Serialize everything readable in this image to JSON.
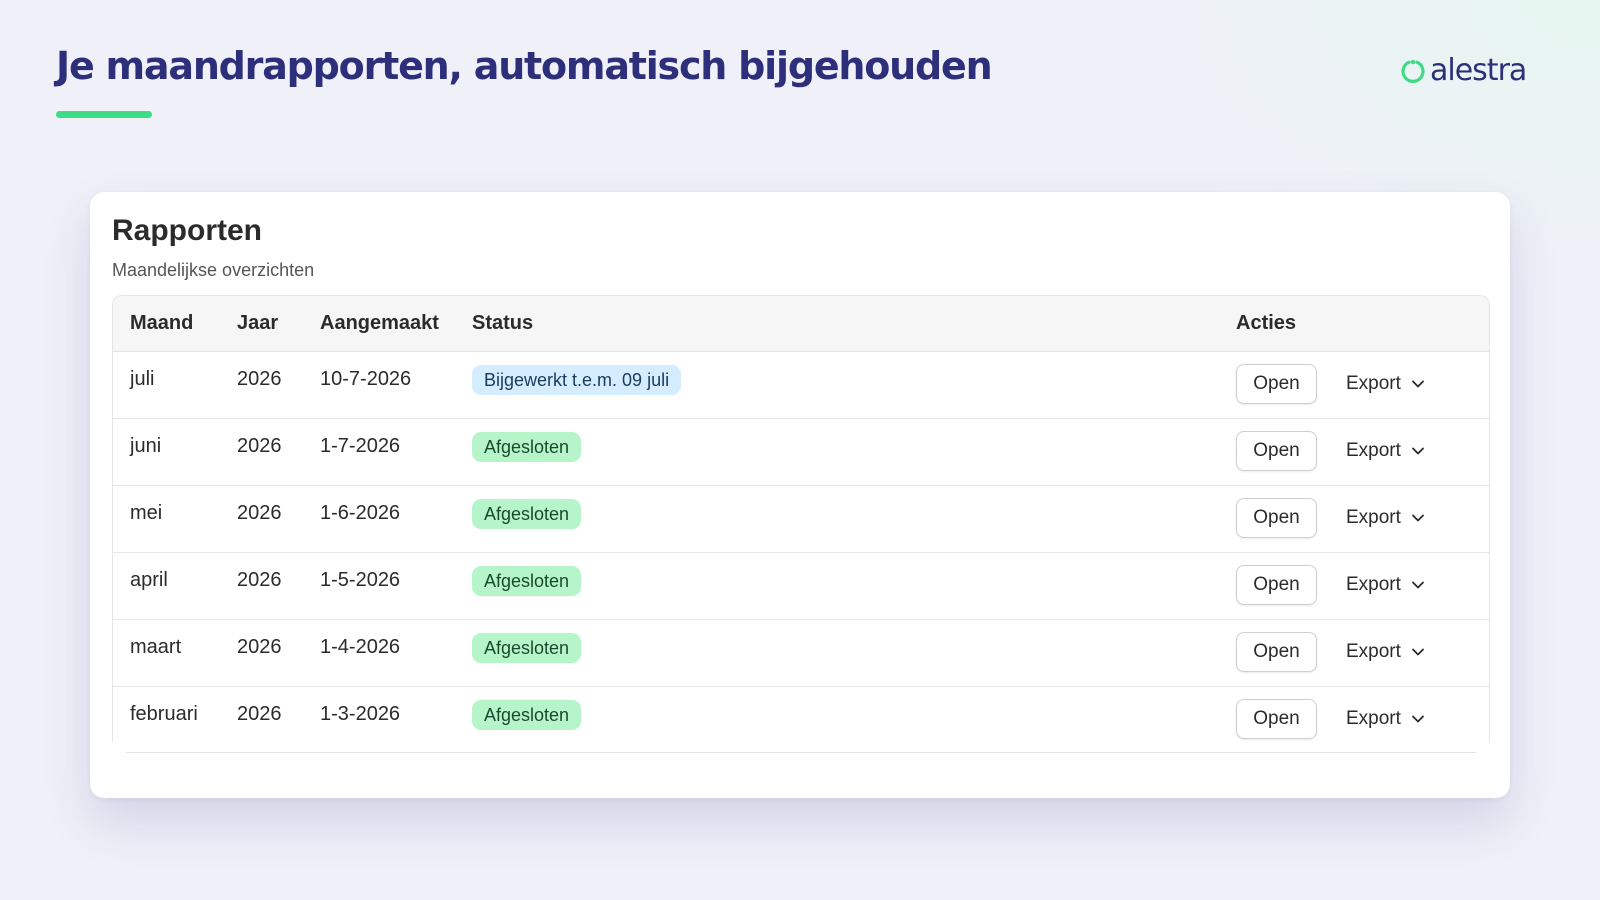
{
  "hero": {
    "title": "Je maandrapporten, automatisch bijgehouden"
  },
  "brand": {
    "name": "alestra",
    "icon": "alestra-logo-mark",
    "accent_color": "#3ddc84",
    "text_color": "#2e2f7a"
  },
  "card": {
    "title": "Rapporten",
    "subtitle": "Maandelijkse overzichten"
  },
  "table": {
    "headers": {
      "month": "Maand",
      "year": "Jaar",
      "created": "Aangemaakt",
      "status": "Status",
      "actions": "Acties"
    },
    "rows": [
      {
        "month": "juli",
        "year": "2026",
        "created": "10-7-2026",
        "status": "Bijgewerkt t.e.m. 09 juli",
        "status_kind": "updated",
        "open_label": "Open",
        "export_label": "Export"
      },
      {
        "month": "juni",
        "year": "2026",
        "created": "1-7-2026",
        "status": "Afgesloten",
        "status_kind": "closed",
        "open_label": "Open",
        "export_label": "Export"
      },
      {
        "month": "mei",
        "year": "2026",
        "created": "1-6-2026",
        "status": "Afgesloten",
        "status_kind": "closed",
        "open_label": "Open",
        "export_label": "Export"
      },
      {
        "month": "april",
        "year": "2026",
        "created": "1-5-2026",
        "status": "Afgesloten",
        "status_kind": "closed",
        "open_label": "Open",
        "export_label": "Export"
      },
      {
        "month": "maart",
        "year": "2026",
        "created": "1-4-2026",
        "status": "Afgesloten",
        "status_kind": "closed",
        "open_label": "Open",
        "export_label": "Export"
      },
      {
        "month": "februari",
        "year": "2026",
        "created": "1-3-2026",
        "status": "Afgesloten",
        "status_kind": "closed",
        "open_label": "Open",
        "export_label": "Export"
      }
    ]
  },
  "colors": {
    "badge_updated_bg": "#d6ecff",
    "badge_closed_bg": "#b5f5c9",
    "title_color": "#2e2f7a",
    "underline_color": "#3ddc84"
  }
}
